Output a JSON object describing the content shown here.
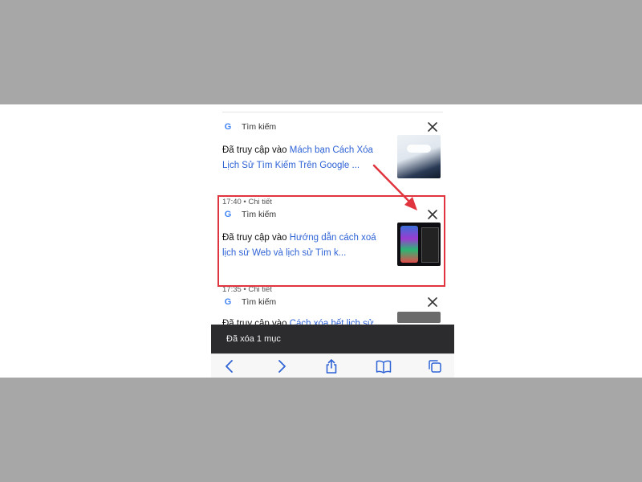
{
  "cards": [
    {
      "source": "Tìm kiếm",
      "visited_prefix": "Đã truy cập vào ",
      "link_line1": "Mách bạn Cách Xóa",
      "link_line2": "Lịch Sử Tìm Kiếm Trên Google ...",
      "meta": "17:40 • Chi tiết"
    },
    {
      "source": "Tìm kiếm",
      "visited_prefix": "Đã truy cập vào ",
      "link_line1": "Hướng dẫn cách xoá",
      "link_line2": "lịch sử Web và lịch sử Tìm k...",
      "meta": "17:35 • Chi tiết"
    },
    {
      "source": "Tìm kiếm",
      "visited_prefix": "Đã truy cập vào ",
      "link_line1": "Cách xóa hết lịch sử"
    }
  ],
  "toast": {
    "message": "Đã xóa 1 mục"
  },
  "toolbar": [
    "back-icon",
    "forward-icon",
    "share-icon",
    "bookmarks-icon",
    "tabs-icon"
  ],
  "colors": {
    "link": "#2f63d6",
    "highlight": "#e0343e",
    "toast_bg": "#2c2c2e"
  }
}
